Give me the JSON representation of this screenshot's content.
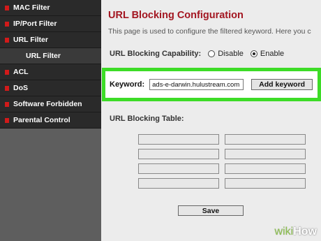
{
  "sidebar": {
    "items": [
      {
        "label": "MAC Filter",
        "sub": false
      },
      {
        "label": "IP/Port Filter",
        "sub": false
      },
      {
        "label": "URL Filter",
        "sub": false
      },
      {
        "label": "URL Filter",
        "sub": true
      },
      {
        "label": "ACL",
        "sub": false
      },
      {
        "label": "DoS",
        "sub": false
      },
      {
        "label": "Software Forbidden",
        "sub": false
      },
      {
        "label": "Parental Control",
        "sub": false
      }
    ]
  },
  "main": {
    "title": "URL Blocking Configuration",
    "description": "This page is used to configure the filtered keyword. Here you c",
    "capability_label": "URL Blocking Capability:",
    "disable_label": "Disable",
    "enable_label": "Enable",
    "selected_capability": "Enable",
    "keyword_label": "Keyword:",
    "keyword_value": "ads-e-darwin.hulustream.com",
    "add_keyword_label": "Add keyword",
    "table_label": "URL Blocking Table:",
    "table_rows": [
      [
        "",
        ""
      ],
      [
        "",
        ""
      ],
      [
        "",
        ""
      ],
      [
        "",
        ""
      ]
    ],
    "save_label": "Save"
  },
  "watermark": {
    "part1": "wiki",
    "part2": "How"
  },
  "colors": {
    "title": "#a31621",
    "highlight": "#3ddc27",
    "marker": "#d21a1a"
  }
}
